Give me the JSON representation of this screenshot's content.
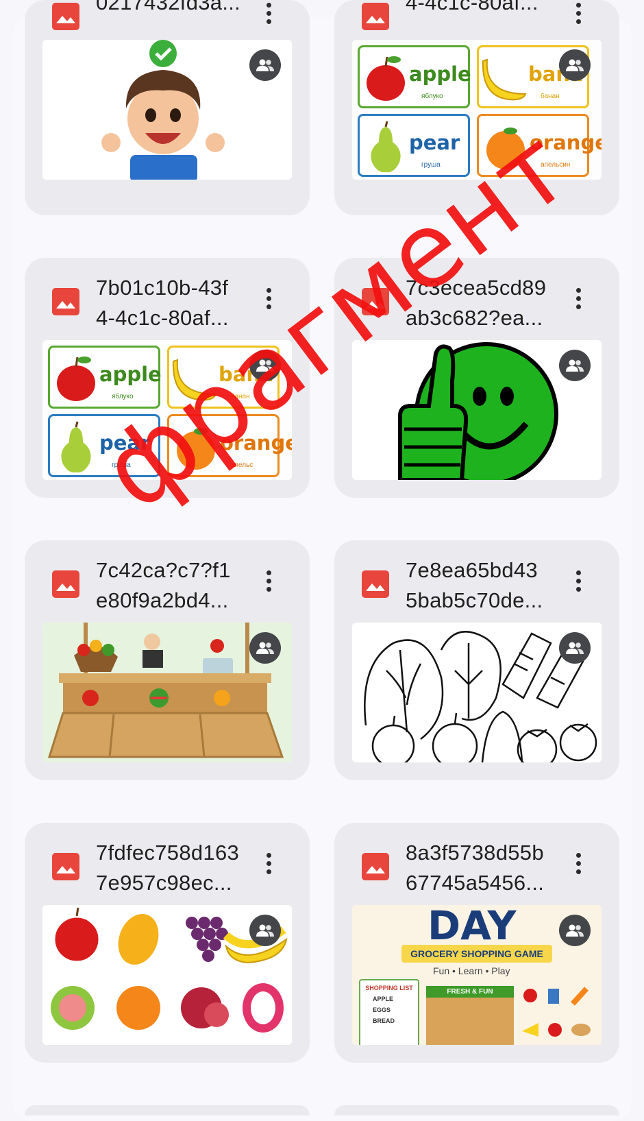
{
  "files": [
    {
      "line1": "",
      "line2": "0217432fd3a...",
      "thumb": "boy-checkmark"
    },
    {
      "line1": "",
      "line2": "4-4c1c-80af...",
      "thumb": "fruit-flashcards"
    },
    {
      "line1": "7b01c10b-43f",
      "line2": "4-4c1c-80af...",
      "thumb": "fruit-flashcards"
    },
    {
      "line1": "7c3ecea5cd89",
      "line2": "ab3c682?ea...",
      "thumb": "green-thumbs-up-smiley"
    },
    {
      "line1": "7c42ca?c7?f1",
      "line2": "e80f9a2bd4...",
      "thumb": "market-stall"
    },
    {
      "line1": "7e8ea65bd43",
      "line2": "5bab5c70de...",
      "thumb": "vegetables-coloring"
    },
    {
      "line1": "7fdfec758d163",
      "line2": "7e957c98ec...",
      "thumb": "fruit-stickers"
    },
    {
      "line1": "8a3f5738d55b",
      "line2": "67745a5456...",
      "thumb": "grocery-game-poster"
    }
  ],
  "flashcards": {
    "apple": {
      "word": "apple",
      "translation": "яблуко"
    },
    "banana": {
      "word": "bana",
      "translation": "банан"
    },
    "pear": {
      "word": "pear",
      "translation": "груша"
    },
    "orange": {
      "word": "orange",
      "translation": "апельсин"
    },
    "orange_cut": {
      "word": "orange",
      "translation": "апельс"
    }
  },
  "poster": {
    "title": "DAY",
    "banner": "GROCERY SHOPPING GAME",
    "tagline": "Fun • Learn • Play",
    "list_title": "SHOPPING LIST",
    "list_items": [
      "APPLE",
      "EGGS",
      "BREAD"
    ],
    "shop_sign": "FRESH & FUN"
  },
  "watermark": "фрагмент",
  "colors": {
    "file_icon": "#e8453c",
    "share_badge": "#444649",
    "card_bg": "#ebebef",
    "watermark": "#f21010"
  }
}
